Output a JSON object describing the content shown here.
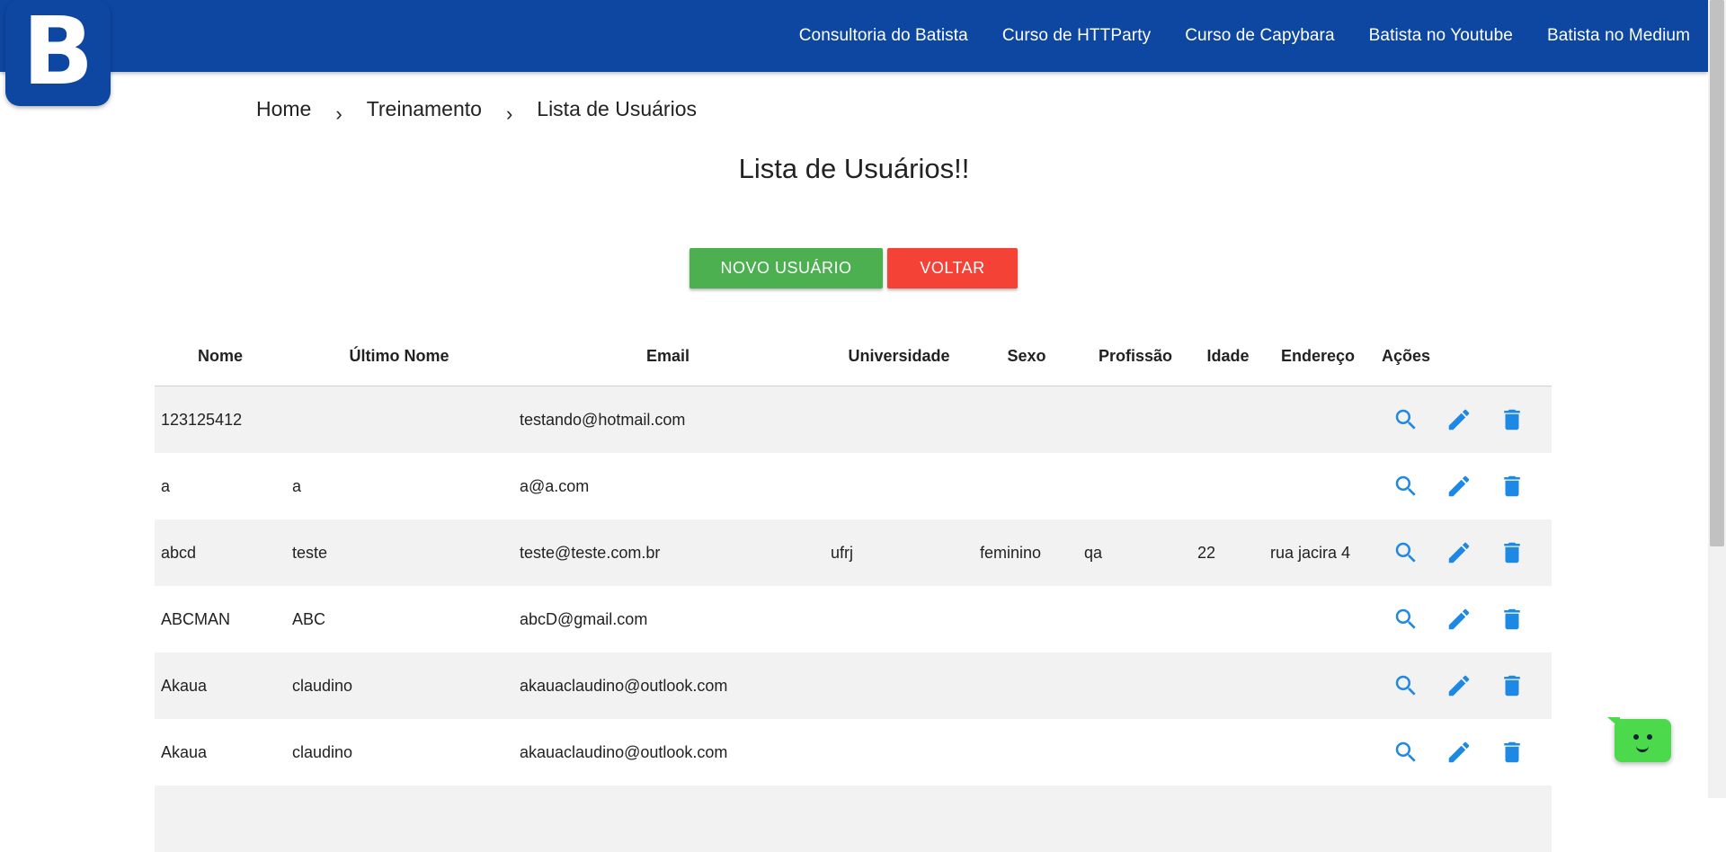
{
  "brand": {
    "logo_letter": "B",
    "color": "#0d47a1"
  },
  "nav": {
    "items": [
      {
        "label": "Consultoria do Batista"
      },
      {
        "label": "Curso de HTTParty"
      },
      {
        "label": "Curso de Capybara"
      },
      {
        "label": "Batista no Youtube"
      },
      {
        "label": "Batista no Medium"
      }
    ]
  },
  "breadcrumb": {
    "items": [
      "Home",
      "Treinamento",
      "Lista de Usuários"
    ],
    "separator": "›"
  },
  "page": {
    "title": "Lista de Usuários!!"
  },
  "actions": {
    "new_user_label": "NOVO USUÁRIO",
    "back_label": "VOLTAR",
    "new_color": "#4caf50",
    "back_color": "#f44336"
  },
  "table": {
    "headers": [
      "Nome",
      "Último Nome",
      "Email",
      "Universidade",
      "Sexo",
      "Profissão",
      "Idade",
      "Endereço",
      "Ações"
    ],
    "rows": [
      [
        "123125412",
        "",
        "testando@hotmail.com",
        "",
        "",
        "",
        "",
        ""
      ],
      [
        "a",
        "a",
        "a@a.com",
        "",
        "",
        "",
        "",
        ""
      ],
      [
        "abcd",
        "teste",
        "teste@teste.com.br",
        "ufrj",
        "feminino",
        "qa",
        "22",
        "rua jacira 4"
      ],
      [
        "ABCMAN",
        "ABC",
        "abcD@gmail.com",
        "",
        "",
        "",
        "",
        ""
      ],
      [
        "Akaua",
        "claudino",
        "akauaclaudino@outlook.com",
        "",
        "",
        "",
        "",
        ""
      ],
      [
        "Akaua",
        "claudino",
        "akauaclaudino@outlook.com",
        "",
        "",
        "",
        "",
        ""
      ]
    ],
    "row_actions": [
      "search-icon",
      "edit-icon",
      "delete-icon"
    ],
    "icon_color": "#1e88e5"
  },
  "chat_widget": {
    "icon": "bot-face-icon",
    "color": "#4cd94c"
  }
}
